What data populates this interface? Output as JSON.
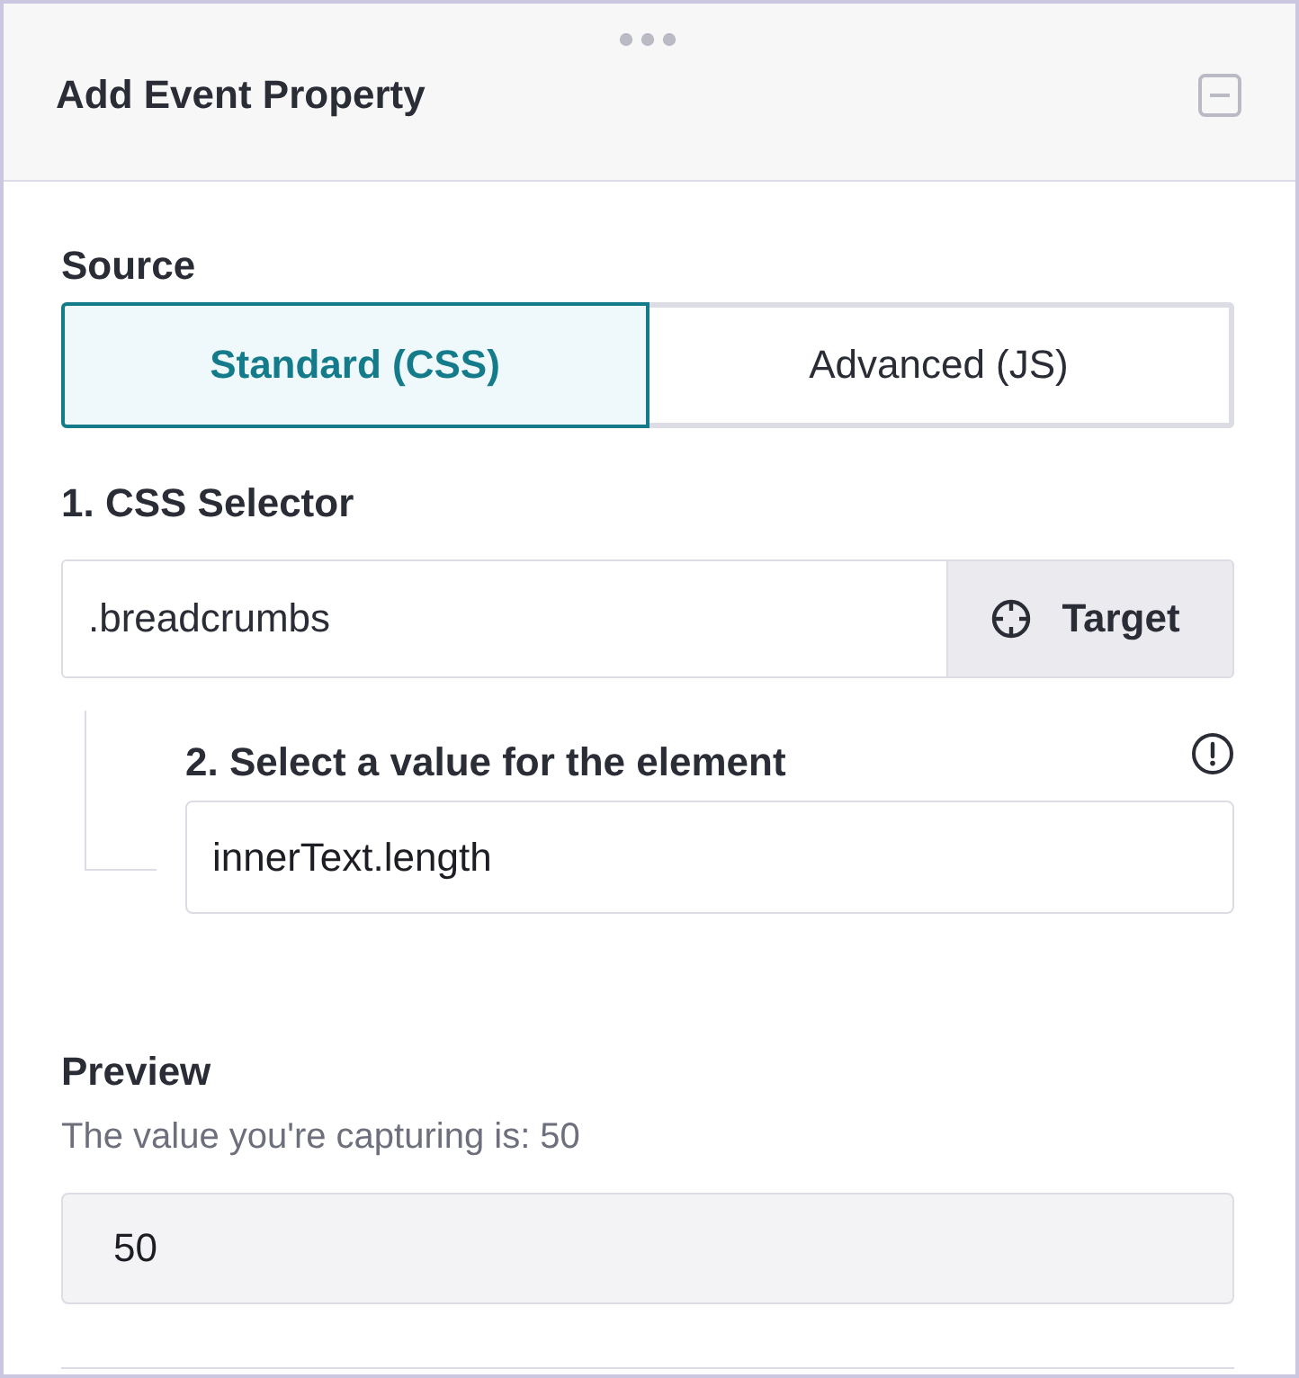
{
  "panel": {
    "title": "Add Event Property"
  },
  "source": {
    "label": "Source",
    "options": [
      {
        "label": "Standard (CSS)",
        "selected": true
      },
      {
        "label": "Advanced (JS)",
        "selected": false
      }
    ]
  },
  "selector": {
    "label": "1. CSS Selector",
    "value": ".breadcrumbs",
    "target_button": "Target"
  },
  "value_step": {
    "label": "2. Select a value for the element",
    "value": "innerText.length"
  },
  "preview": {
    "label": "Preview",
    "description": "The value you're capturing is: 50",
    "value": "50",
    "read_only": true
  }
}
